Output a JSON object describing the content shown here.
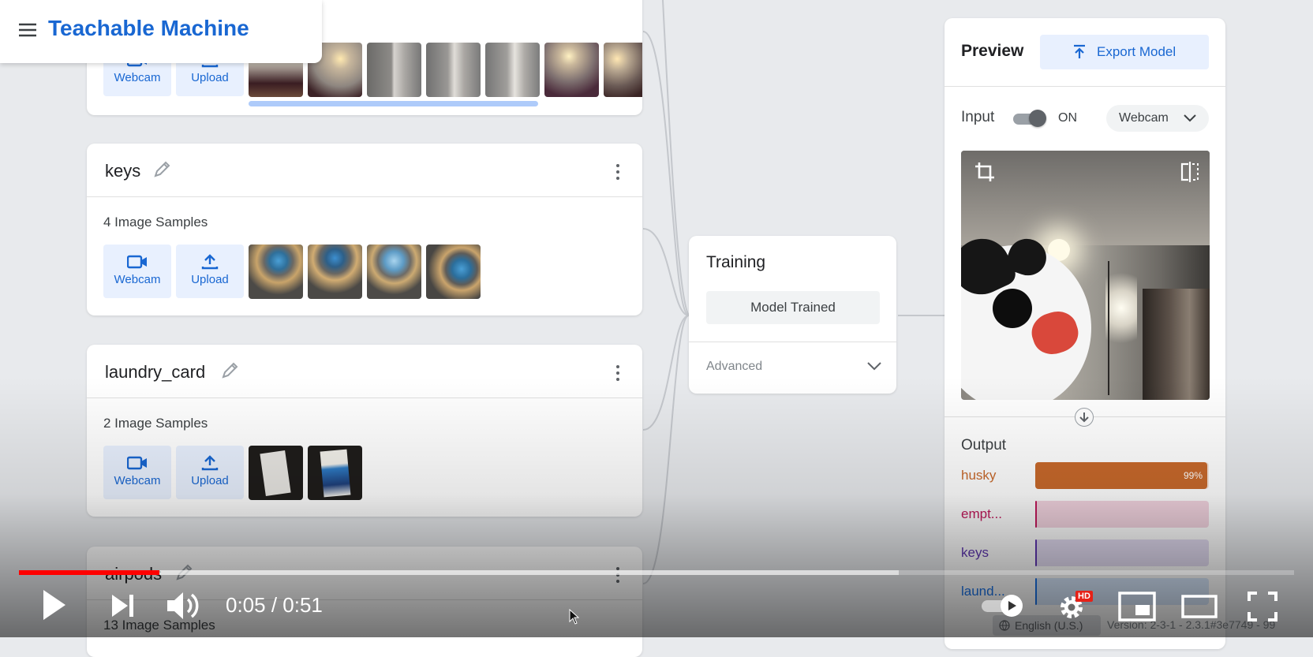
{
  "app": {
    "title": "Teachable Machine"
  },
  "classes": [
    {
      "name": "keys",
      "samples_label": "4 Image Samples",
      "webcam_label": "Webcam",
      "upload_label": "Upload"
    },
    {
      "name": "laundry_card",
      "samples_label": "2 Image Samples",
      "webcam_label": "Webcam",
      "upload_label": "Upload"
    },
    {
      "name": "airpods",
      "samples_label": "13 Image Samples"
    }
  ],
  "top_class": {
    "webcam_label": "Webcam",
    "upload_label": "Upload"
  },
  "training": {
    "title": "Training",
    "button_label": "Model Trained",
    "advanced_label": "Advanced"
  },
  "preview": {
    "title": "Preview",
    "export_label": "Export Model",
    "input_label": "Input",
    "toggle_state": "ON",
    "source_select": "Webcam",
    "output_title": "Output",
    "outputs": [
      {
        "label": "husky",
        "percent_text": "99%",
        "value": 0.99,
        "color": "#c8692b"
      },
      {
        "label": "empt...",
        "percent_text": "",
        "value": 0.01,
        "color": "#c2185b"
      },
      {
        "label": "keys",
        "percent_text": "",
        "value": 0.0,
        "color": "#5e35b1"
      },
      {
        "label": "laund...",
        "percent_text": "",
        "value": 0.0,
        "color": "#1a73e8"
      }
    ]
  },
  "footer": {
    "language": "English (U.S.)",
    "version": "Version: 2-3-1 - 2.3.1#3e7749 - 99"
  },
  "player": {
    "current_time": "0:05",
    "separator": " / ",
    "duration": "0:51",
    "played_fraction": 0.11,
    "buffered_fraction": 0.69,
    "hd_badge": "HD",
    "colors": {
      "progress": "#ff0000",
      "accent_blue": "#1967d2"
    }
  }
}
